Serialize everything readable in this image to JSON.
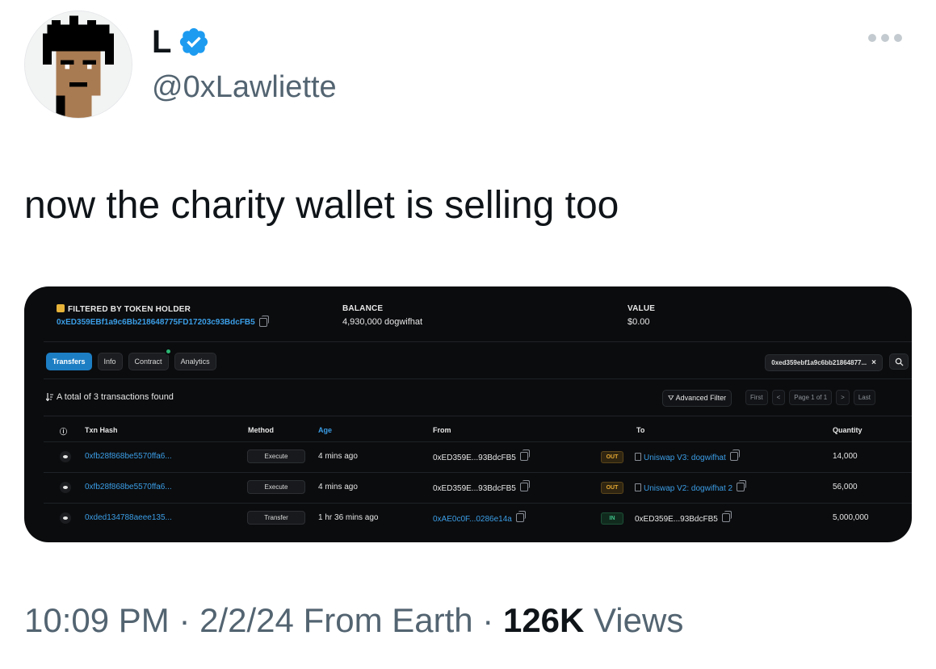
{
  "tweet": {
    "display_name": "L",
    "handle": "@0xLawliette",
    "text": "now the charity wallet is selling too",
    "time": "10:09 PM",
    "date": "2/2/24",
    "location": "From Earth",
    "separator": "·",
    "views_count": "126K",
    "views_label": "Views"
  },
  "etherscan": {
    "filter_label": "FILTERED BY TOKEN HOLDER",
    "holder_address": "0xED359EBf1a9c6Bb218648775FD17203c93BdcFB5",
    "balance_label": "BALANCE",
    "balance_value": "4,930,000 dogwifhat",
    "value_label": "VALUE",
    "value_amount": "$0.00",
    "tabs": [
      "Transfers",
      "Info",
      "Contract",
      "Analytics"
    ],
    "filter_chip": "0xed359ebf1a9c6bb21864877...",
    "total_text": "A total of 3 transactions found",
    "advanced_filter": "Advanced Filter",
    "pager": [
      "First",
      "<",
      "Page 1 of 1",
      ">",
      "Last"
    ],
    "columns": [
      "Txn Hash",
      "Method",
      "Age",
      "From",
      "To",
      "Quantity"
    ],
    "rows": [
      {
        "hash": "0xfb28f868be5570ffa6...",
        "method": "Execute",
        "age": "4 mins ago",
        "from": "0xED359E...93BdcFB5",
        "dir": "OUT",
        "to": "Uniswap V3: dogwifhat",
        "qty": "14,000"
      },
      {
        "hash": "0xfb28f868be5570ffa6...",
        "method": "Execute",
        "age": "4 mins ago",
        "from": "0xED359E...93BdcFB5",
        "dir": "OUT",
        "to": "Uniswap V2: dogwifhat 2",
        "qty": "56,000"
      },
      {
        "hash": "0xded134788aeee135...",
        "method": "Transfer",
        "age": "1 hr 36 mins ago",
        "from": "0xAE0c0F...0286e14a",
        "dir": "IN",
        "to": "0xED359E...93BdcFB5",
        "qty": "5,000,000"
      }
    ]
  },
  "colors": {
    "accent": "#1d9bf0",
    "card_bg": "#0b0c0e",
    "link": "#3b9ee6",
    "muted": "#536471"
  },
  "icons": {
    "verified": "verified-badge-icon",
    "more": "more-icon",
    "copy": "copy-icon",
    "search": "search-icon",
    "eye": "eye-icon"
  }
}
